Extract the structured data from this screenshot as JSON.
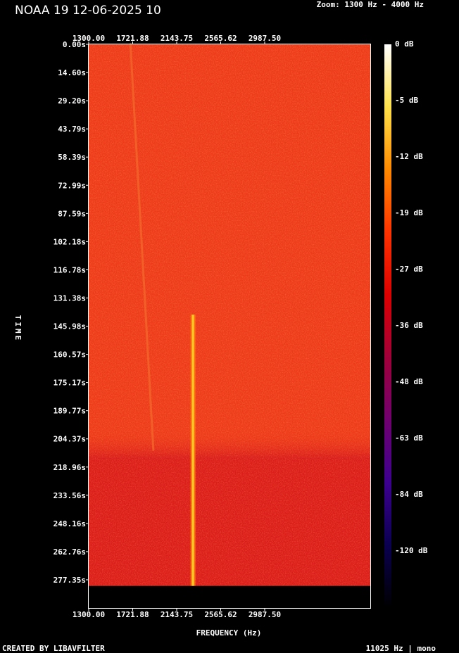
{
  "header": {
    "title": "NOAA 19 12-06-2025 10",
    "zoom": "Zoom: 1300 Hz - 4000 Hz"
  },
  "footer": {
    "created_by": "CREATED BY LIBAVFILTER",
    "sample_info": "11025 Hz | mono"
  },
  "chart_data": {
    "type": "heatmap",
    "title": "NOAA 19 12-06-2025 10",
    "xlabel": "FREQUENCY (Hz)",
    "ylabel": "TIME",
    "xlim": [
      1300,
      4000
    ],
    "ylim": [
      0,
      291.94
    ],
    "x_ticks": [
      "1300.00",
      "1721.88",
      "2143.75",
      "2565.62",
      "2987.50"
    ],
    "y_ticks": [
      "0.00s",
      "14.60s",
      "29.20s",
      "43.79s",
      "58.39s",
      "72.99s",
      "87.59s",
      "102.18s",
      "116.78s",
      "131.38s",
      "145.98s",
      "160.57s",
      "175.17s",
      "189.77s",
      "204.37s",
      "218.96s",
      "233.56s",
      "248.16s",
      "262.76s",
      "277.35s"
    ],
    "colorbar": {
      "label_unit": "dB",
      "ticks": [
        "0 dB",
        "-5 dB",
        "-12 dB",
        "-19 dB",
        "-27 dB",
        "-36 dB",
        "-48 dB",
        "-63 dB",
        "-84 dB",
        "-120 dB"
      ],
      "colors": [
        "#ffffff",
        "#ffe24a",
        "#ff8a00",
        "#ff3300",
        "#dd0000",
        "#a0003a",
        "#700070",
        "#3c0090",
        "#0a0050",
        "#000000"
      ]
    },
    "background_color": "#ee3a1c",
    "lower_band_color": "#dc1d1c",
    "signal": {
      "frequency_hz": 2300,
      "start_s": 140,
      "end_s": 280.5,
      "color": "#ffcc22"
    },
    "faint_trace": {
      "frequency_start_hz": 1700,
      "frequency_end_hz": 1920,
      "start_s": 0,
      "end_s": 210,
      "color": "#f2692a"
    },
    "data_end_s": 280.5
  }
}
